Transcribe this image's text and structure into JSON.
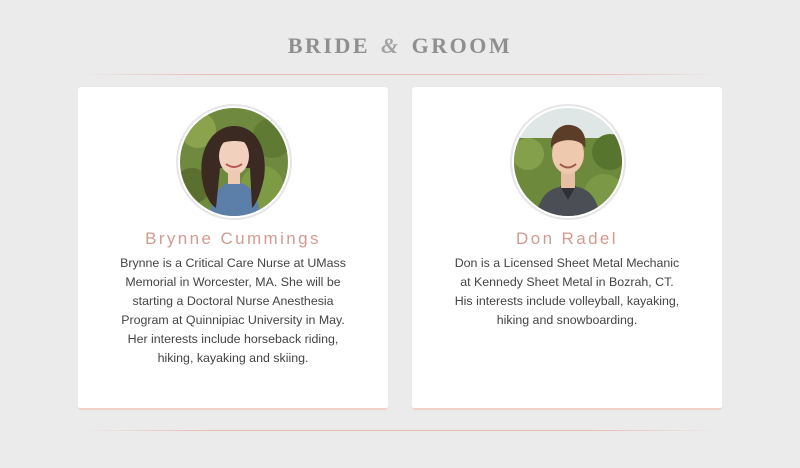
{
  "header": {
    "title_part1": "BRIDE",
    "title_amp": "&",
    "title_part2": "GROOM"
  },
  "people": [
    {
      "name": "Brynne Cummings",
      "bio": "Brynne is a Critical Care Nurse at UMass Memorial in Worcester, MA. She will be starting a Doctoral Nurse Anesthesia Program at Quinnipiac University in May. Her interests include horseback riding, hiking, kayaking and skiing."
    },
    {
      "name": "Don Radel",
      "bio": "Don is a Licensed Sheet Metal Mechanic at Kennedy Sheet Metal in Bozrah, CT. His interests include volleyball, kayaking, hiking and snowboarding."
    }
  ],
  "colors": {
    "background": "#ebebeb",
    "card": "#ffffff",
    "accent_name": "#d39a90",
    "rule": "#e8beb4",
    "title": "#8f8f8f"
  }
}
